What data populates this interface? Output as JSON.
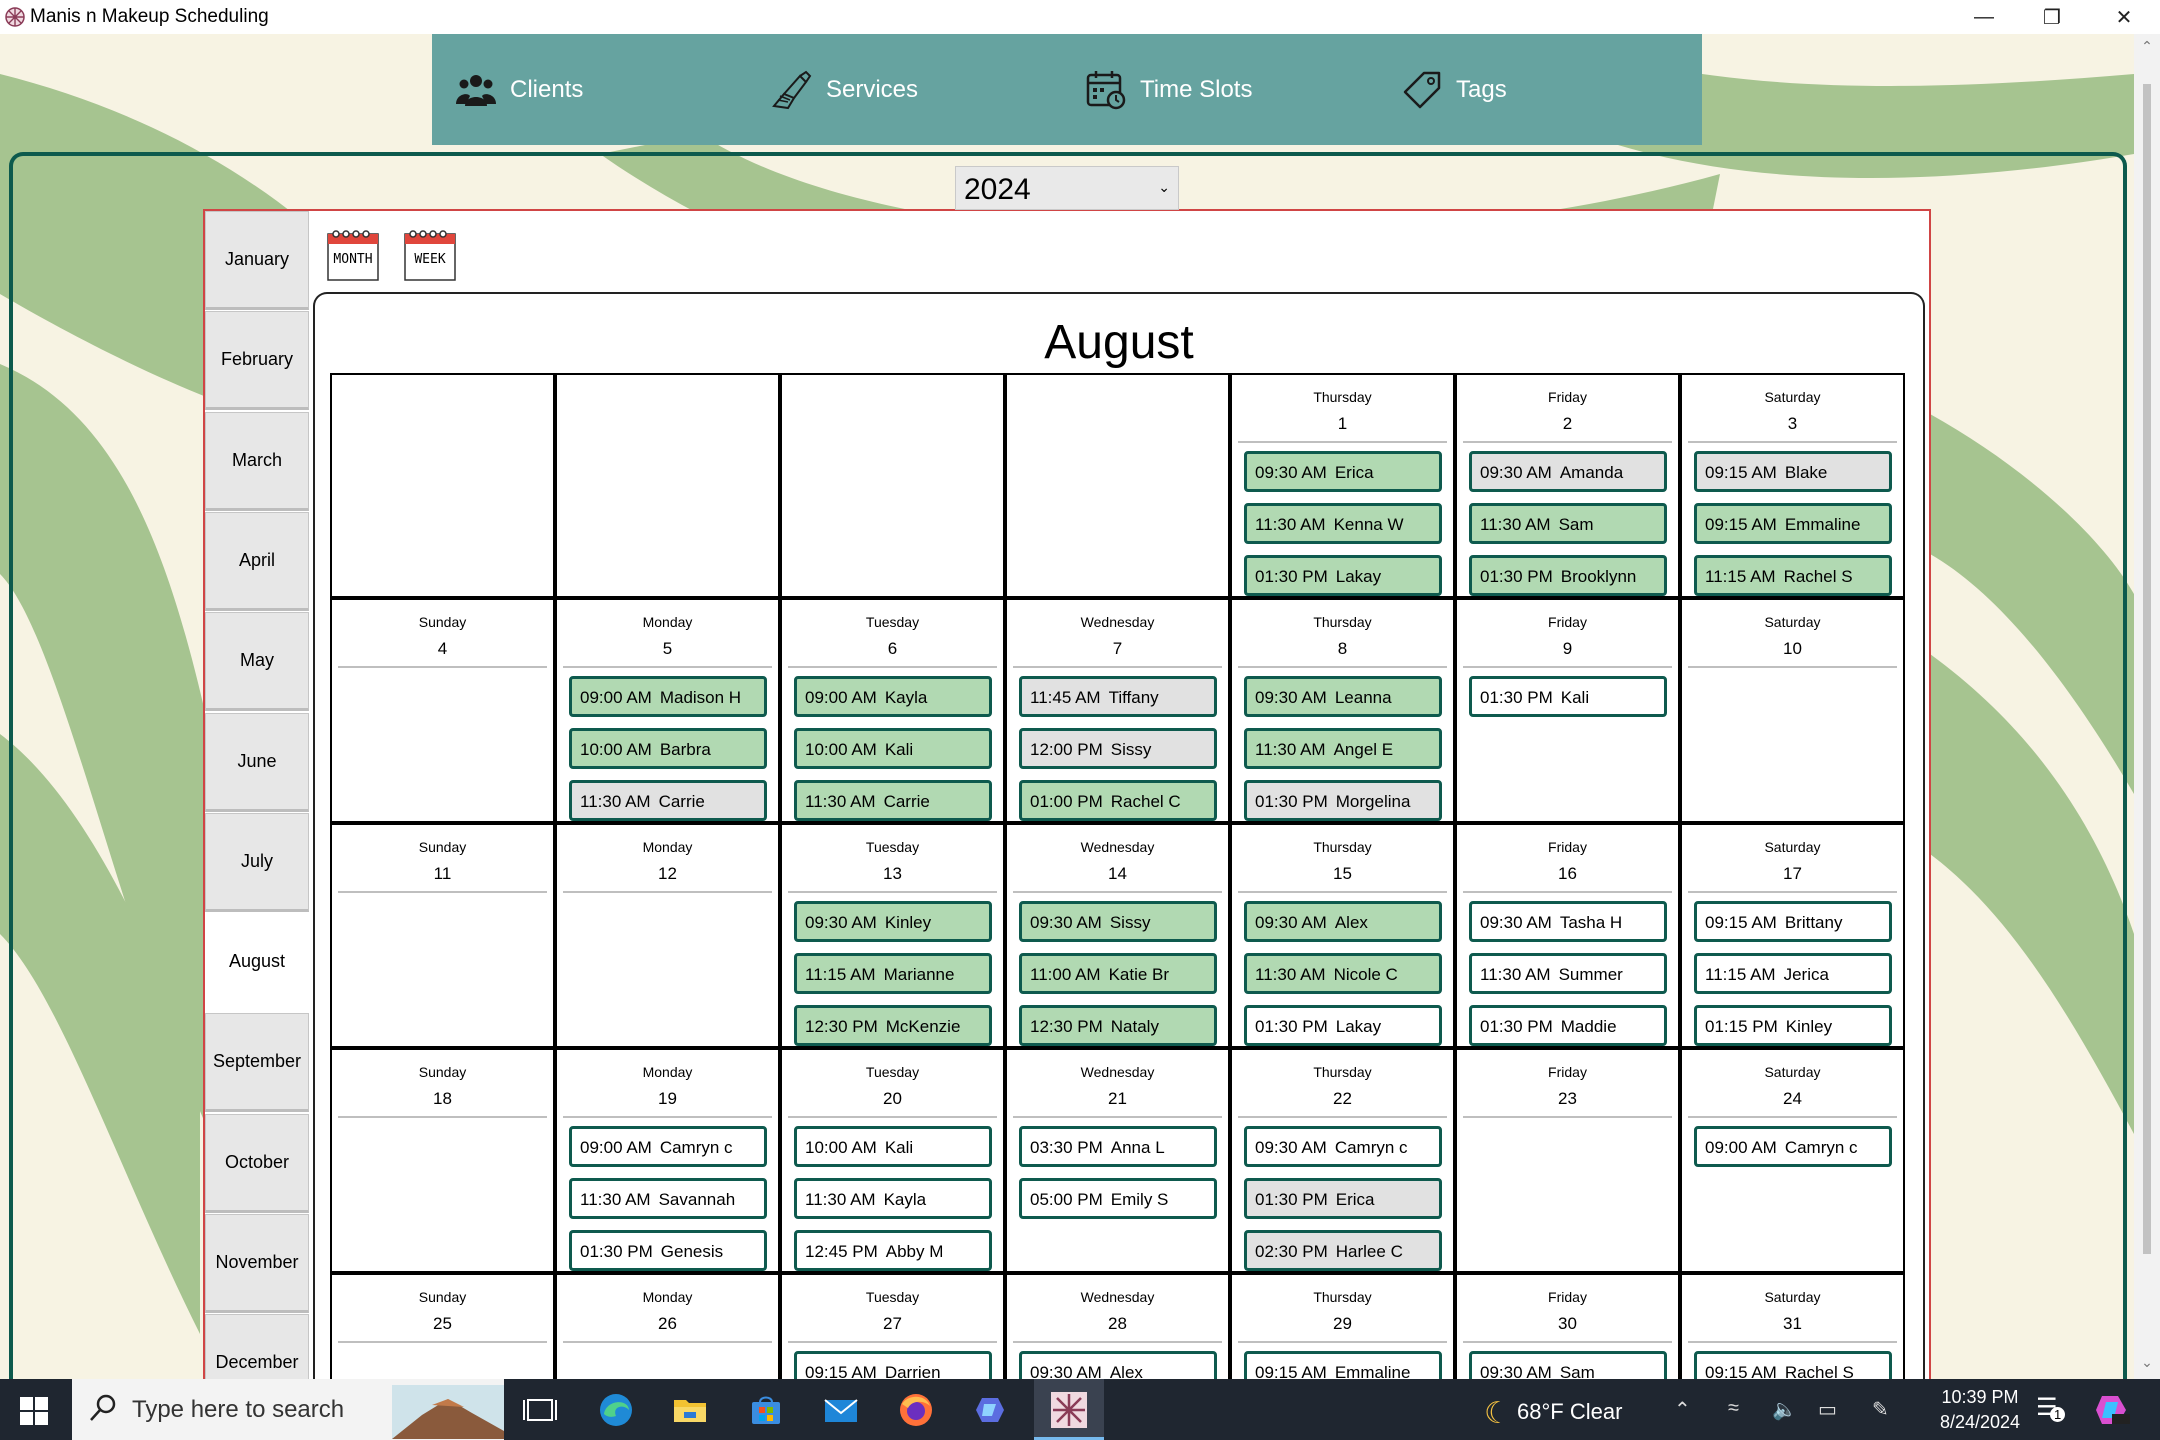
{
  "window": {
    "title": "Manis n Makeup Scheduling"
  },
  "nav": [
    {
      "label": "Clients",
      "icon": "clients-icon"
    },
    {
      "label": "Services",
      "icon": "services-icon"
    },
    {
      "label": "Time Slots",
      "icon": "time-slots-icon"
    },
    {
      "label": "Tags",
      "icon": "tag-icon"
    }
  ],
  "year": "2024",
  "months": [
    "January",
    "February",
    "March",
    "April",
    "May",
    "June",
    "July",
    "August",
    "September",
    "October",
    "November",
    "December"
  ],
  "selected_month": "August",
  "view_toggles": {
    "month": "MONTH",
    "week": "WEEK"
  },
  "calendar": {
    "title": "August",
    "colors": {
      "green": "#b1d9b2",
      "gray": "#e1e1e1",
      "white": "#ffffff",
      "border": "#0e5a4e"
    },
    "weeks": [
      [
        null,
        null,
        null,
        null,
        {
          "dow": "Thursday",
          "day": "1",
          "appts": [
            {
              "time": "09:30 AM",
              "name": "Erica",
              "color": "green"
            },
            {
              "time": "11:30 AM",
              "name": "Kenna W",
              "color": "green"
            },
            {
              "time": "01:30 PM",
              "name": "Lakay",
              "color": "green"
            }
          ]
        },
        {
          "dow": "Friday",
          "day": "2",
          "appts": [
            {
              "time": "09:30 AM",
              "name": "Amanda",
              "color": "gray"
            },
            {
              "time": "11:30 AM",
              "name": "Sam",
              "color": "green"
            },
            {
              "time": "01:30 PM",
              "name": "Brooklynn",
              "color": "green"
            }
          ]
        },
        {
          "dow": "Saturday",
          "day": "3",
          "appts": [
            {
              "time": "09:15 AM",
              "name": "Blake",
              "color": "gray"
            },
            {
              "time": "09:15 AM",
              "name": "Emmaline",
              "color": "green"
            },
            {
              "time": "11:15 AM",
              "name": "Rachel S",
              "color": "green"
            }
          ]
        }
      ],
      [
        {
          "dow": "Sunday",
          "day": "4",
          "appts": []
        },
        {
          "dow": "Monday",
          "day": "5",
          "appts": [
            {
              "time": "09:00 AM",
              "name": "Madison H",
              "color": "green"
            },
            {
              "time": "10:00 AM",
              "name": "Barbra",
              "color": "green"
            },
            {
              "time": "11:30 AM",
              "name": "Carrie",
              "color": "gray"
            }
          ]
        },
        {
          "dow": "Tuesday",
          "day": "6",
          "appts": [
            {
              "time": "09:00 AM",
              "name": "Kayla",
              "color": "green"
            },
            {
              "time": "10:00 AM",
              "name": "Kali",
              "color": "green"
            },
            {
              "time": "11:30 AM",
              "name": "Carrie",
              "color": "green"
            }
          ]
        },
        {
          "dow": "Wednesday",
          "day": "7",
          "appts": [
            {
              "time": "11:45 AM",
              "name": "Tiffany",
              "color": "gray"
            },
            {
              "time": "12:00 PM",
              "name": "Sissy",
              "color": "gray"
            },
            {
              "time": "01:00 PM",
              "name": "Rachel C",
              "color": "green"
            }
          ]
        },
        {
          "dow": "Thursday",
          "day": "8",
          "appts": [
            {
              "time": "09:30 AM",
              "name": "Leanna",
              "color": "green"
            },
            {
              "time": "11:30 AM",
              "name": "Angel E",
              "color": "green"
            },
            {
              "time": "01:30 PM",
              "name": "Morgelina",
              "color": "gray"
            }
          ]
        },
        {
          "dow": "Friday",
          "day": "9",
          "appts": [
            {
              "time": "01:30 PM",
              "name": "Kali",
              "color": "white"
            }
          ]
        },
        {
          "dow": "Saturday",
          "day": "10",
          "appts": []
        }
      ],
      [
        {
          "dow": "Sunday",
          "day": "11",
          "appts": []
        },
        {
          "dow": "Monday",
          "day": "12",
          "appts": []
        },
        {
          "dow": "Tuesday",
          "day": "13",
          "appts": [
            {
              "time": "09:30 AM",
              "name": "Kinley",
              "color": "green"
            },
            {
              "time": "11:15 AM",
              "name": "Marianne",
              "color": "green"
            },
            {
              "time": "12:30 PM",
              "name": "McKenzie",
              "color": "green"
            }
          ]
        },
        {
          "dow": "Wednesday",
          "day": "14",
          "appts": [
            {
              "time": "09:30 AM",
              "name": "Sissy",
              "color": "green"
            },
            {
              "time": "11:00 AM",
              "name": "Katie Br",
              "color": "green"
            },
            {
              "time": "12:30 PM",
              "name": "Nataly",
              "color": "green"
            }
          ]
        },
        {
          "dow": "Thursday",
          "day": "15",
          "appts": [
            {
              "time": "09:30 AM",
              "name": "Alex",
              "color": "green"
            },
            {
              "time": "11:30 AM",
              "name": "Nicole C",
              "color": "green"
            },
            {
              "time": "01:30 PM",
              "name": "Lakay",
              "color": "white"
            }
          ]
        },
        {
          "dow": "Friday",
          "day": "16",
          "appts": [
            {
              "time": "09:30 AM",
              "name": "Tasha H",
              "color": "white"
            },
            {
              "time": "11:30 AM",
              "name": "Summer",
              "color": "white"
            },
            {
              "time": "01:30 PM",
              "name": "Maddie",
              "color": "white"
            }
          ]
        },
        {
          "dow": "Saturday",
          "day": "17",
          "appts": [
            {
              "time": "09:15 AM",
              "name": "Brittany",
              "color": "white"
            },
            {
              "time": "11:15 AM",
              "name": "Jerica",
              "color": "white"
            },
            {
              "time": "01:15 PM",
              "name": "Kinley",
              "color": "white"
            }
          ]
        }
      ],
      [
        {
          "dow": "Sunday",
          "day": "18",
          "appts": []
        },
        {
          "dow": "Monday",
          "day": "19",
          "appts": [
            {
              "time": "09:00 AM",
              "name": "Camryn c",
              "color": "white"
            },
            {
              "time": "11:30 AM",
              "name": "Savannah",
              "color": "white"
            },
            {
              "time": "01:30 PM",
              "name": "Genesis",
              "color": "white"
            }
          ]
        },
        {
          "dow": "Tuesday",
          "day": "20",
          "appts": [
            {
              "time": "10:00 AM",
              "name": "Kali",
              "color": "white"
            },
            {
              "time": "11:30 AM",
              "name": "Kayla",
              "color": "white"
            },
            {
              "time": "12:45 PM",
              "name": "Abby M",
              "color": "white"
            }
          ]
        },
        {
          "dow": "Wednesday",
          "day": "21",
          "appts": [
            {
              "time": "03:30 PM",
              "name": "Anna L",
              "color": "white"
            },
            {
              "time": "05:00 PM",
              "name": "Emily S",
              "color": "white"
            }
          ]
        },
        {
          "dow": "Thursday",
          "day": "22",
          "appts": [
            {
              "time": "09:30 AM",
              "name": "Camryn c",
              "color": "white"
            },
            {
              "time": "01:30 PM",
              "name": "Erica",
              "color": "gray"
            },
            {
              "time": "02:30 PM",
              "name": "Harlee C",
              "color": "gray"
            }
          ]
        },
        {
          "dow": "Friday",
          "day": "23",
          "appts": []
        },
        {
          "dow": "Saturday",
          "day": "24",
          "appts": [
            {
              "time": "09:00 AM",
              "name": "Camryn c",
              "color": "white"
            }
          ]
        }
      ],
      [
        {
          "dow": "Sunday",
          "day": "25",
          "appts": []
        },
        {
          "dow": "Monday",
          "day": "26",
          "appts": []
        },
        {
          "dow": "Tuesday",
          "day": "27",
          "appts": [
            {
              "time": "09:15 AM",
              "name": "Darrien",
              "color": "white"
            }
          ]
        },
        {
          "dow": "Wednesday",
          "day": "28",
          "appts": [
            {
              "time": "09:30 AM",
              "name": "Alex",
              "color": "white"
            }
          ]
        },
        {
          "dow": "Thursday",
          "day": "29",
          "appts": [
            {
              "time": "09:15 AM",
              "name": "Emmaline",
              "color": "white"
            }
          ]
        },
        {
          "dow": "Friday",
          "day": "30",
          "appts": [
            {
              "time": "09:30 AM",
              "name": "Sam",
              "color": "white"
            }
          ]
        },
        {
          "dow": "Saturday",
          "day": "31",
          "appts": [
            {
              "time": "09:15 AM",
              "name": "Rachel S",
              "color": "white"
            }
          ]
        }
      ]
    ]
  },
  "taskbar": {
    "search_placeholder": "Type here to search",
    "weather": "68°F  Clear",
    "time": "10:39 PM",
    "date": "8/24/2024",
    "notification_count": "1",
    "apps": [
      "task-view-icon",
      "edge-icon",
      "file-explorer-icon",
      "store-icon",
      "mail-icon",
      "firefox-icon",
      "copilot-icon",
      "scheduling-app-icon"
    ]
  }
}
